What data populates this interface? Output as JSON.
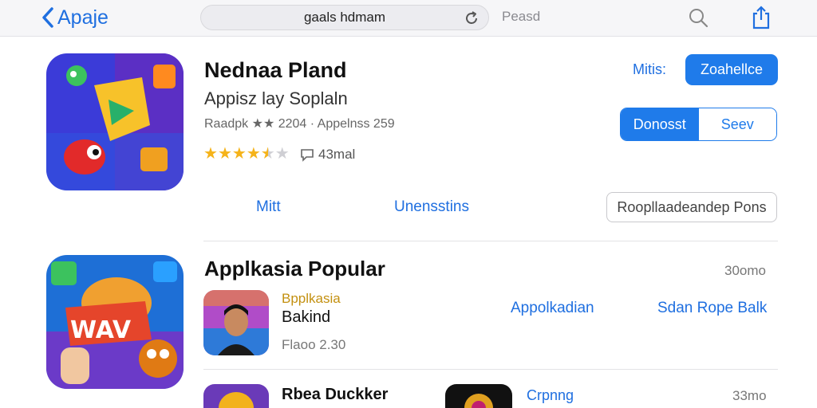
{
  "nav": {
    "back_label": "Apaje",
    "search_text": "gaals hdmam",
    "extra_label": "Peasd",
    "search_icon": "search-icon",
    "share_icon": "share-icon",
    "reload_icon": "reload-icon"
  },
  "featured": {
    "title": "Nednaa Pland",
    "subtitle": "Appisz lay Soplaln",
    "meta": "Raadpk ★★ 2204 · Appelnss 259",
    "rating_stars": 4.5,
    "rating_count": "43mal",
    "rating_icon": "comment-icon",
    "right_label": "Mitis:",
    "primary_button": "Zoahellce",
    "segment": [
      "Donosst",
      "Seev"
    ],
    "links": [
      "Mitt",
      "Unensstins"
    ],
    "outline_button": "Roopllaadeandep Pons"
  },
  "popular": {
    "title": "Applkasia Popular",
    "see_more": "30omo",
    "item1": {
      "category": "Bpplkasia",
      "name": "Bakind",
      "price": "Flaoo 2.30"
    },
    "links": [
      "Appolkadian",
      "Sdan Rope Balk"
    ]
  },
  "bottom_row": {
    "item_name": "Rbea Duckker",
    "item_label": "Crpnng",
    "see_more": "33mo"
  },
  "colors": {
    "accent": "#1f7bea",
    "star": "#f5b31a",
    "category": "#c39010"
  }
}
